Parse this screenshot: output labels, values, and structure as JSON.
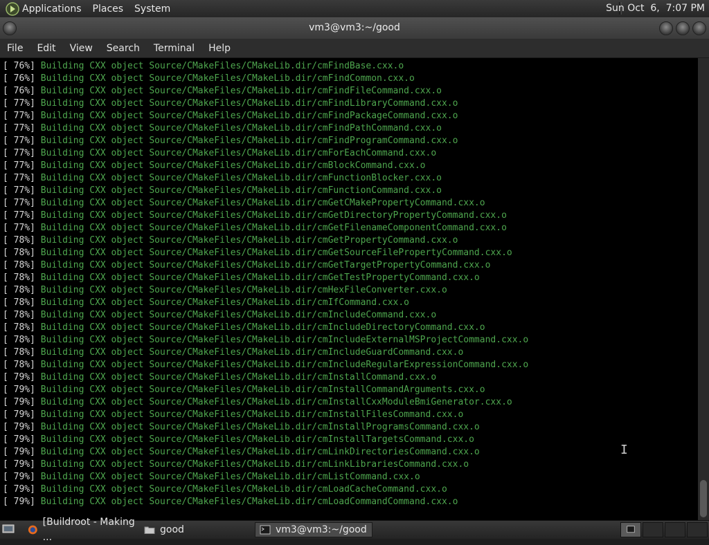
{
  "top_panel": {
    "menus": [
      "Applications",
      "Places",
      "System"
    ],
    "clock": "Sun Oct  6,  7:07 PM"
  },
  "window": {
    "title": "vm3@vm3:~/good"
  },
  "menubar": [
    "File",
    "Edit",
    "View",
    "Search",
    "Terminal",
    "Help"
  ],
  "terminal_lines": [
    {
      "pct": "[ 76%]",
      "msg": "Building CXX object Source/CMakeFiles/CMakeLib.dir/cmFindBase.cxx.o"
    },
    {
      "pct": "[ 76%]",
      "msg": "Building CXX object Source/CMakeFiles/CMakeLib.dir/cmFindCommon.cxx.o"
    },
    {
      "pct": "[ 76%]",
      "msg": "Building CXX object Source/CMakeFiles/CMakeLib.dir/cmFindFileCommand.cxx.o"
    },
    {
      "pct": "[ 77%]",
      "msg": "Building CXX object Source/CMakeFiles/CMakeLib.dir/cmFindLibraryCommand.cxx.o"
    },
    {
      "pct": "[ 77%]",
      "msg": "Building CXX object Source/CMakeFiles/CMakeLib.dir/cmFindPackageCommand.cxx.o"
    },
    {
      "pct": "[ 77%]",
      "msg": "Building CXX object Source/CMakeFiles/CMakeLib.dir/cmFindPathCommand.cxx.o"
    },
    {
      "pct": "[ 77%]",
      "msg": "Building CXX object Source/CMakeFiles/CMakeLib.dir/cmFindProgramCommand.cxx.o"
    },
    {
      "pct": "[ 77%]",
      "msg": "Building CXX object Source/CMakeFiles/CMakeLib.dir/cmForEachCommand.cxx.o"
    },
    {
      "pct": "[ 77%]",
      "msg": "Building CXX object Source/CMakeFiles/CMakeLib.dir/cmBlockCommand.cxx.o"
    },
    {
      "pct": "[ 77%]",
      "msg": "Building CXX object Source/CMakeFiles/CMakeLib.dir/cmFunctionBlocker.cxx.o"
    },
    {
      "pct": "[ 77%]",
      "msg": "Building CXX object Source/CMakeFiles/CMakeLib.dir/cmFunctionCommand.cxx.o"
    },
    {
      "pct": "[ 77%]",
      "msg": "Building CXX object Source/CMakeFiles/CMakeLib.dir/cmGetCMakePropertyCommand.cxx.o"
    },
    {
      "pct": "[ 77%]",
      "msg": "Building CXX object Source/CMakeFiles/CMakeLib.dir/cmGetDirectoryPropertyCommand.cxx.o"
    },
    {
      "pct": "[ 77%]",
      "msg": "Building CXX object Source/CMakeFiles/CMakeLib.dir/cmGetFilenameComponentCommand.cxx.o"
    },
    {
      "pct": "[ 78%]",
      "msg": "Building CXX object Source/CMakeFiles/CMakeLib.dir/cmGetPropertyCommand.cxx.o"
    },
    {
      "pct": "[ 78%]",
      "msg": "Building CXX object Source/CMakeFiles/CMakeLib.dir/cmGetSourceFilePropertyCommand.cxx.o"
    },
    {
      "pct": "[ 78%]",
      "msg": "Building CXX object Source/CMakeFiles/CMakeLib.dir/cmGetTargetPropertyCommand.cxx.o"
    },
    {
      "pct": "[ 78%]",
      "msg": "Building CXX object Source/CMakeFiles/CMakeLib.dir/cmGetTestPropertyCommand.cxx.o"
    },
    {
      "pct": "[ 78%]",
      "msg": "Building CXX object Source/CMakeFiles/CMakeLib.dir/cmHexFileConverter.cxx.o"
    },
    {
      "pct": "[ 78%]",
      "msg": "Building CXX object Source/CMakeFiles/CMakeLib.dir/cmIfCommand.cxx.o"
    },
    {
      "pct": "[ 78%]",
      "msg": "Building CXX object Source/CMakeFiles/CMakeLib.dir/cmIncludeCommand.cxx.o"
    },
    {
      "pct": "[ 78%]",
      "msg": "Building CXX object Source/CMakeFiles/CMakeLib.dir/cmIncludeDirectoryCommand.cxx.o"
    },
    {
      "pct": "[ 78%]",
      "msg": "Building CXX object Source/CMakeFiles/CMakeLib.dir/cmIncludeExternalMSProjectCommand.cxx.o"
    },
    {
      "pct": "[ 78%]",
      "msg": "Building CXX object Source/CMakeFiles/CMakeLib.dir/cmIncludeGuardCommand.cxx.o"
    },
    {
      "pct": "[ 78%]",
      "msg": "Building CXX object Source/CMakeFiles/CMakeLib.dir/cmIncludeRegularExpressionCommand.cxx.o"
    },
    {
      "pct": "[ 79%]",
      "msg": "Building CXX object Source/CMakeFiles/CMakeLib.dir/cmInstallCommand.cxx.o"
    },
    {
      "pct": "[ 79%]",
      "msg": "Building CXX object Source/CMakeFiles/CMakeLib.dir/cmInstallCommandArguments.cxx.o"
    },
    {
      "pct": "[ 79%]",
      "msg": "Building CXX object Source/CMakeFiles/CMakeLib.dir/cmInstallCxxModuleBmiGenerator.cxx.o"
    },
    {
      "pct": "[ 79%]",
      "msg": "Building CXX object Source/CMakeFiles/CMakeLib.dir/cmInstallFilesCommand.cxx.o"
    },
    {
      "pct": "[ 79%]",
      "msg": "Building CXX object Source/CMakeFiles/CMakeLib.dir/cmInstallProgramsCommand.cxx.o"
    },
    {
      "pct": "[ 79%]",
      "msg": "Building CXX object Source/CMakeFiles/CMakeLib.dir/cmInstallTargetsCommand.cxx.o"
    },
    {
      "pct": "[ 79%]",
      "msg": "Building CXX object Source/CMakeFiles/CMakeLib.dir/cmLinkDirectoriesCommand.cxx.o"
    },
    {
      "pct": "[ 79%]",
      "msg": "Building CXX object Source/CMakeFiles/CMakeLib.dir/cmLinkLibrariesCommand.cxx.o"
    },
    {
      "pct": "[ 79%]",
      "msg": "Building CXX object Source/CMakeFiles/CMakeLib.dir/cmListCommand.cxx.o"
    },
    {
      "pct": "[ 79%]",
      "msg": "Building CXX object Source/CMakeFiles/CMakeLib.dir/cmLoadCacheCommand.cxx.o"
    },
    {
      "pct": "[ 79%]",
      "msg": "Building CXX object Source/CMakeFiles/CMakeLib.dir/cmLoadCommandCommand.cxx.o"
    }
  ],
  "taskbar": {
    "tasks": [
      {
        "label": "[Buildroot - Making ...",
        "icon": "firefox-icon",
        "active": false
      },
      {
        "label": "good",
        "icon": "folder-icon",
        "active": false
      },
      {
        "label": "vm3@vm3:~/good",
        "icon": "terminal-icon",
        "active": true
      }
    ]
  },
  "colors": {
    "terminal_bg": "#000000",
    "terminal_green": "#4ea64e",
    "terminal_text": "#d8d8d8"
  }
}
